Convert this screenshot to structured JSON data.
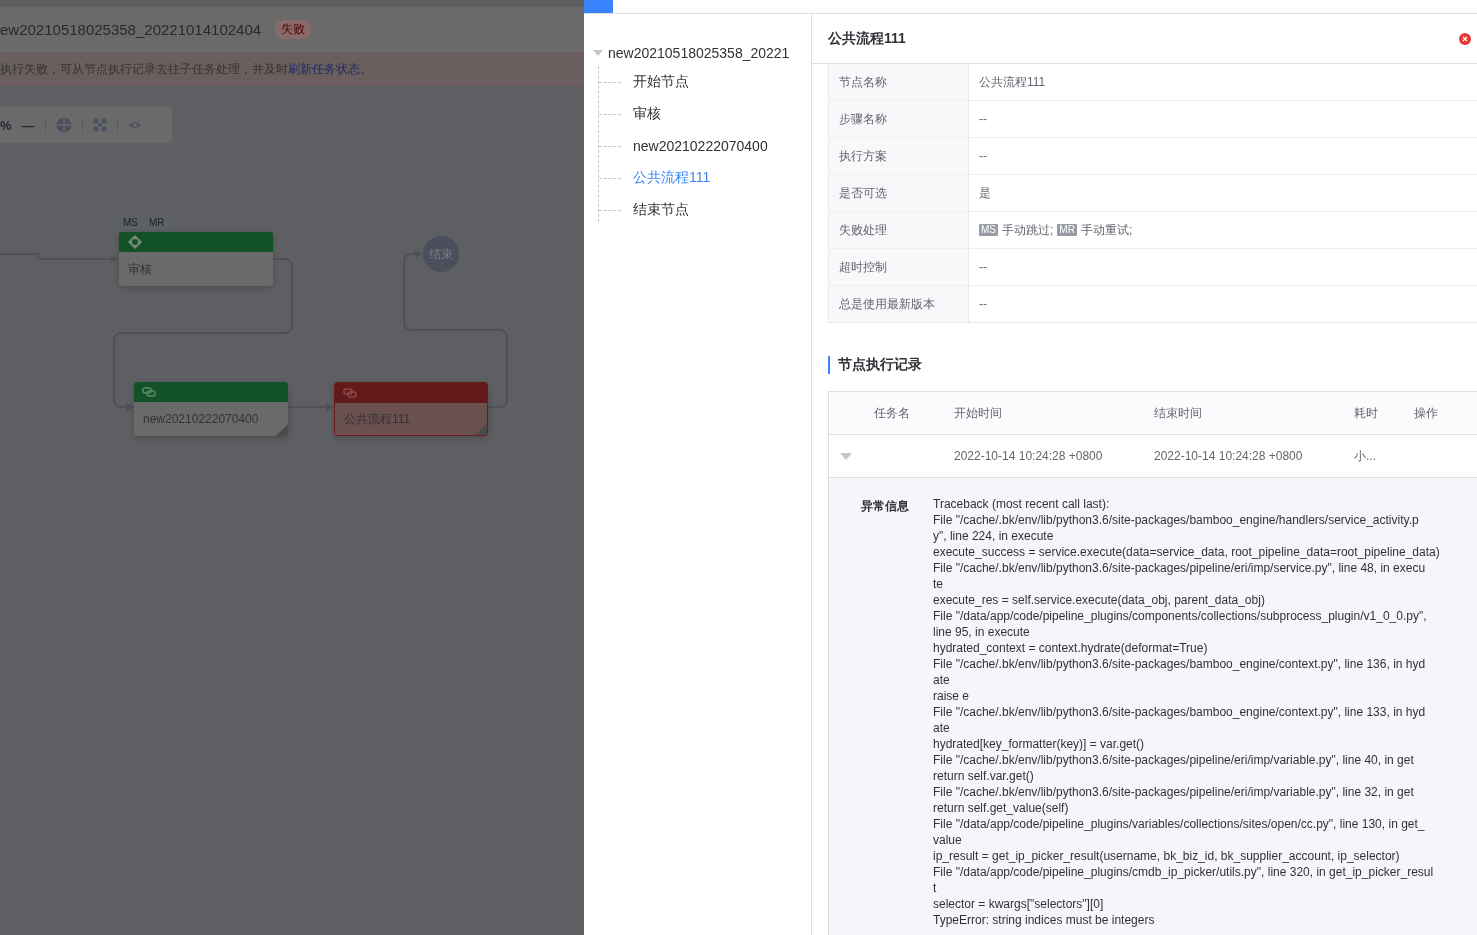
{
  "background_page": {
    "title": "ew20210518025358_20221014102404",
    "status_badge": "失败",
    "alert": {
      "text": "执行失败，可从节点执行记录去往子任务处理，并及时",
      "link": "刷新任务状态",
      "suffix": "。"
    },
    "toolbar": {
      "zoom_label": "%",
      "zoom_out": "—"
    },
    "flow": {
      "nodes": [
        {
          "kind": "task",
          "label": "审核",
          "failed": false,
          "tags": [
            "MS",
            "MR"
          ]
        },
        {
          "kind": "subprocess",
          "label": "new20210222070400",
          "failed": false
        },
        {
          "kind": "subprocess",
          "label": "公共流程111",
          "failed": true
        },
        {
          "kind": "end",
          "label": "结束"
        }
      ]
    }
  },
  "tree": {
    "label": "new20210518025358_20221",
    "expanded": true,
    "children": [
      {
        "label": "开始节点",
        "selected": false
      },
      {
        "label": "审核",
        "selected": false
      },
      {
        "label": "new20210222070400",
        "selected": false
      },
      {
        "label": "公共流程111",
        "selected": true
      },
      {
        "label": "结束节点",
        "selected": false
      }
    ]
  },
  "detail": {
    "title": "公共流程111",
    "fields": [
      {
        "kind": "text",
        "label": "节点名称",
        "value": "公共流程111"
      },
      {
        "kind": "text",
        "label": "步骤名称",
        "value": "--"
      },
      {
        "kind": "text",
        "label": "执行方案",
        "value": "--"
      },
      {
        "kind": "text",
        "label": "是否可选",
        "value": "是"
      },
      {
        "kind": "tags",
        "label": "失败处理",
        "items": [
          {
            "tag": "MS",
            "text": "手动跳过;"
          },
          {
            "tag": "MR",
            "text": "手动重试;"
          }
        ]
      },
      {
        "kind": "text",
        "label": "超时控制",
        "value": "--"
      },
      {
        "kind": "text",
        "label": "总是使用最新版本",
        "value": "--"
      }
    ]
  },
  "records": {
    "title": "节点执行记录",
    "columns": [
      "任务名",
      "开始时间",
      "结束时间",
      "耗时",
      "操作"
    ],
    "rows": [
      {
        "expanded": true,
        "start": "2022-10-14 10:24:28 +0800",
        "end": "2022-10-14 10:24:28 +0800",
        "duration": "小...",
        "error": {
          "label": "异常信息",
          "lines": [
            "Traceback (most recent call last):",
            "File \"/cache/.bk/env/lib/python3.6/site-packages/bamboo_engine/handlers/service_activity.p",
            "y\", line 224, in execute",
            "execute_success = service.execute(data=service_data, root_pipeline_data=root_pipeline_data)",
            "File \"/cache/.bk/env/lib/python3.6/site-packages/pipeline/eri/imp/service.py\", line 48, in execu",
            "te",
            "execute_res = self.service.execute(data_obj, parent_data_obj)",
            "File \"/data/app/code/pipeline_plugins/components/collections/subprocess_plugin/v1_0_0.py\",",
            "line 95, in execute",
            "hydrated_context = context.hydrate(deformat=True)",
            "File \"/cache/.bk/env/lib/python3.6/site-packages/bamboo_engine/context.py\", line 136, in hyd",
            "ate",
            "raise e",
            "File \"/cache/.bk/env/lib/python3.6/site-packages/bamboo_engine/context.py\", line 133, in hyd",
            "ate",
            "hydrated[key_formatter(key)] = var.get()",
            "File \"/cache/.bk/env/lib/python3.6/site-packages/pipeline/eri/imp/variable.py\", line 40, in get",
            "return self.var.get()",
            "File \"/cache/.bk/env/lib/python3.6/site-packages/pipeline/eri/imp/variable.py\", line 32, in get",
            "return self.get_value(self)",
            "File \"/data/app/code/pipeline_plugins/variables/collections/sites/open/cc.py\", line 130, in get_",
            "value",
            "ip_result = get_ip_picker_result(username, bk_biz_id, bk_supplier_account, ip_selector)",
            "File \"/data/app/code/pipeline_plugins/cmdb_ip_picker/utils.py\", line 320, in get_ip_picker_resul",
            "t",
            "selector = kwargs[\"selectors\"][0]",
            "TypeError: string indices must be integers"
          ]
        }
      }
    ]
  }
}
